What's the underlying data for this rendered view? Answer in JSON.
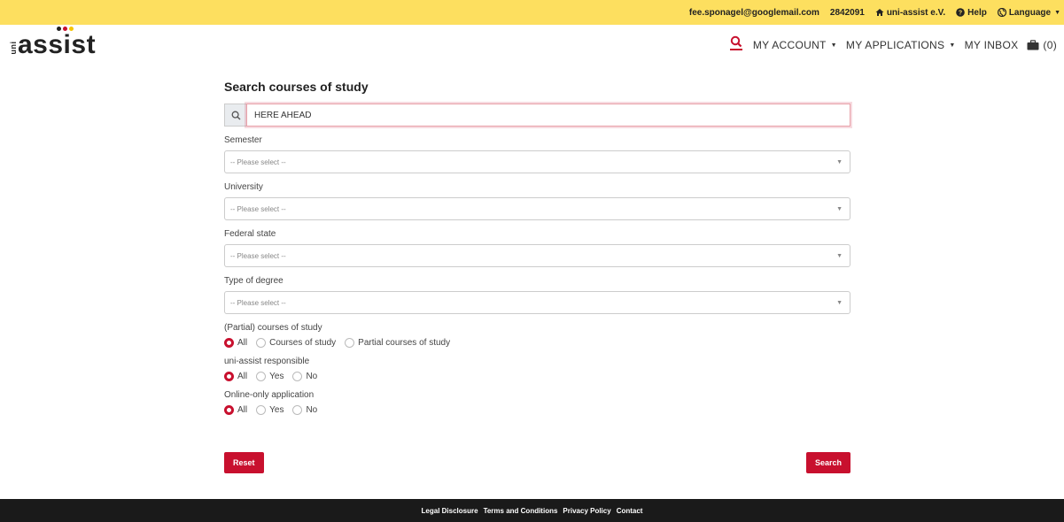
{
  "topbar": {
    "email": "fee.sponagel@googlemail.com",
    "user_id": "2842091",
    "org": "uni-assist e.V.",
    "help": "Help",
    "language": "Language"
  },
  "logo": {
    "uni": "uni",
    "word": "assist",
    "dot_colors": [
      "#222222",
      "#c8102e",
      "#f5c400"
    ]
  },
  "nav": {
    "my_account": "MY ACCOUNT",
    "my_applications": "MY APPLICATIONS",
    "my_inbox": "MY INBOX",
    "cart": "(0)"
  },
  "page": {
    "title": "Search courses of study",
    "search_value": "HERE AHEAD"
  },
  "filters": [
    {
      "label": "Semester",
      "value": "-- Please select --"
    },
    {
      "label": "University",
      "value": "-- Please select --"
    },
    {
      "label": "Federal state",
      "value": "-- Please select --"
    },
    {
      "label": "Type of degree",
      "value": "-- Please select --"
    }
  ],
  "radio_groups": [
    {
      "label": "(Partial) courses of study",
      "options": [
        "All",
        "Courses of study",
        "Partial courses of study"
      ],
      "selected": "All"
    },
    {
      "label": "uni-assist responsible",
      "options": [
        "All",
        "Yes",
        "No"
      ],
      "selected": "All"
    },
    {
      "label": "Online-only application",
      "options": [
        "All",
        "Yes",
        "No"
      ],
      "selected": "All"
    }
  ],
  "buttons": {
    "reset": "Reset",
    "search": "Search"
  },
  "footer": {
    "legal": "Legal Disclosure",
    "terms": "Terms and Conditions",
    "privacy": "Privacy Policy",
    "contact": "Contact"
  },
  "colors": {
    "accent": "#c8102e",
    "topbar": "#fddf5f",
    "footer": "#1a1a1a"
  }
}
